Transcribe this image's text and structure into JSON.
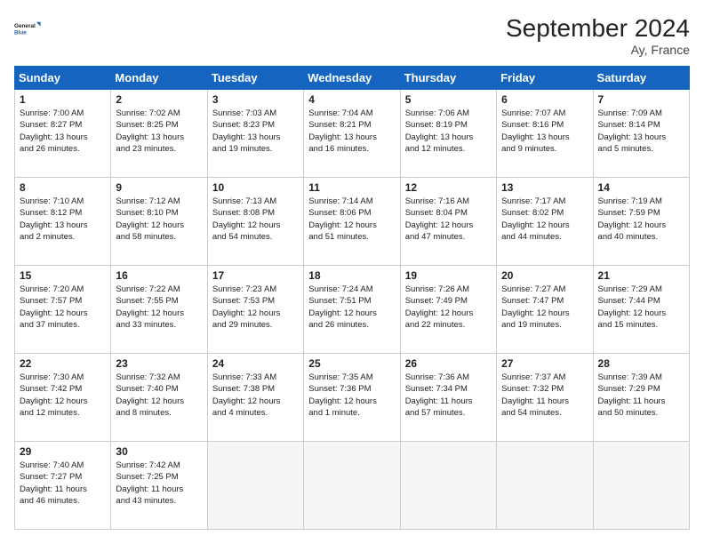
{
  "header": {
    "logo_line1": "General",
    "logo_line2": "Blue",
    "month": "September 2024",
    "location": "Ay, France"
  },
  "days_of_week": [
    "Sunday",
    "Monday",
    "Tuesday",
    "Wednesday",
    "Thursday",
    "Friday",
    "Saturday"
  ],
  "weeks": [
    [
      {
        "day": "1",
        "lines": [
          "Sunrise: 7:00 AM",
          "Sunset: 8:27 PM",
          "Daylight: 13 hours",
          "and 26 minutes."
        ]
      },
      {
        "day": "2",
        "lines": [
          "Sunrise: 7:02 AM",
          "Sunset: 8:25 PM",
          "Daylight: 13 hours",
          "and 23 minutes."
        ]
      },
      {
        "day": "3",
        "lines": [
          "Sunrise: 7:03 AM",
          "Sunset: 8:23 PM",
          "Daylight: 13 hours",
          "and 19 minutes."
        ]
      },
      {
        "day": "4",
        "lines": [
          "Sunrise: 7:04 AM",
          "Sunset: 8:21 PM",
          "Daylight: 13 hours",
          "and 16 minutes."
        ]
      },
      {
        "day": "5",
        "lines": [
          "Sunrise: 7:06 AM",
          "Sunset: 8:19 PM",
          "Daylight: 13 hours",
          "and 12 minutes."
        ]
      },
      {
        "day": "6",
        "lines": [
          "Sunrise: 7:07 AM",
          "Sunset: 8:16 PM",
          "Daylight: 13 hours",
          "and 9 minutes."
        ]
      },
      {
        "day": "7",
        "lines": [
          "Sunrise: 7:09 AM",
          "Sunset: 8:14 PM",
          "Daylight: 13 hours",
          "and 5 minutes."
        ]
      }
    ],
    [
      {
        "day": "8",
        "lines": [
          "Sunrise: 7:10 AM",
          "Sunset: 8:12 PM",
          "Daylight: 13 hours",
          "and 2 minutes."
        ]
      },
      {
        "day": "9",
        "lines": [
          "Sunrise: 7:12 AM",
          "Sunset: 8:10 PM",
          "Daylight: 12 hours",
          "and 58 minutes."
        ]
      },
      {
        "day": "10",
        "lines": [
          "Sunrise: 7:13 AM",
          "Sunset: 8:08 PM",
          "Daylight: 12 hours",
          "and 54 minutes."
        ]
      },
      {
        "day": "11",
        "lines": [
          "Sunrise: 7:14 AM",
          "Sunset: 8:06 PM",
          "Daylight: 12 hours",
          "and 51 minutes."
        ]
      },
      {
        "day": "12",
        "lines": [
          "Sunrise: 7:16 AM",
          "Sunset: 8:04 PM",
          "Daylight: 12 hours",
          "and 47 minutes."
        ]
      },
      {
        "day": "13",
        "lines": [
          "Sunrise: 7:17 AM",
          "Sunset: 8:02 PM",
          "Daylight: 12 hours",
          "and 44 minutes."
        ]
      },
      {
        "day": "14",
        "lines": [
          "Sunrise: 7:19 AM",
          "Sunset: 7:59 PM",
          "Daylight: 12 hours",
          "and 40 minutes."
        ]
      }
    ],
    [
      {
        "day": "15",
        "lines": [
          "Sunrise: 7:20 AM",
          "Sunset: 7:57 PM",
          "Daylight: 12 hours",
          "and 37 minutes."
        ]
      },
      {
        "day": "16",
        "lines": [
          "Sunrise: 7:22 AM",
          "Sunset: 7:55 PM",
          "Daylight: 12 hours",
          "and 33 minutes."
        ]
      },
      {
        "day": "17",
        "lines": [
          "Sunrise: 7:23 AM",
          "Sunset: 7:53 PM",
          "Daylight: 12 hours",
          "and 29 minutes."
        ]
      },
      {
        "day": "18",
        "lines": [
          "Sunrise: 7:24 AM",
          "Sunset: 7:51 PM",
          "Daylight: 12 hours",
          "and 26 minutes."
        ]
      },
      {
        "day": "19",
        "lines": [
          "Sunrise: 7:26 AM",
          "Sunset: 7:49 PM",
          "Daylight: 12 hours",
          "and 22 minutes."
        ]
      },
      {
        "day": "20",
        "lines": [
          "Sunrise: 7:27 AM",
          "Sunset: 7:47 PM",
          "Daylight: 12 hours",
          "and 19 minutes."
        ]
      },
      {
        "day": "21",
        "lines": [
          "Sunrise: 7:29 AM",
          "Sunset: 7:44 PM",
          "Daylight: 12 hours",
          "and 15 minutes."
        ]
      }
    ],
    [
      {
        "day": "22",
        "lines": [
          "Sunrise: 7:30 AM",
          "Sunset: 7:42 PM",
          "Daylight: 12 hours",
          "and 12 minutes."
        ]
      },
      {
        "day": "23",
        "lines": [
          "Sunrise: 7:32 AM",
          "Sunset: 7:40 PM",
          "Daylight: 12 hours",
          "and 8 minutes."
        ]
      },
      {
        "day": "24",
        "lines": [
          "Sunrise: 7:33 AM",
          "Sunset: 7:38 PM",
          "Daylight: 12 hours",
          "and 4 minutes."
        ]
      },
      {
        "day": "25",
        "lines": [
          "Sunrise: 7:35 AM",
          "Sunset: 7:36 PM",
          "Daylight: 12 hours",
          "and 1 minute."
        ]
      },
      {
        "day": "26",
        "lines": [
          "Sunrise: 7:36 AM",
          "Sunset: 7:34 PM",
          "Daylight: 11 hours",
          "and 57 minutes."
        ]
      },
      {
        "day": "27",
        "lines": [
          "Sunrise: 7:37 AM",
          "Sunset: 7:32 PM",
          "Daylight: 11 hours",
          "and 54 minutes."
        ]
      },
      {
        "day": "28",
        "lines": [
          "Sunrise: 7:39 AM",
          "Sunset: 7:29 PM",
          "Daylight: 11 hours",
          "and 50 minutes."
        ]
      }
    ],
    [
      {
        "day": "29",
        "lines": [
          "Sunrise: 7:40 AM",
          "Sunset: 7:27 PM",
          "Daylight: 11 hours",
          "and 46 minutes."
        ]
      },
      {
        "day": "30",
        "lines": [
          "Sunrise: 7:42 AM",
          "Sunset: 7:25 PM",
          "Daylight: 11 hours",
          "and 43 minutes."
        ]
      },
      {
        "day": "",
        "lines": []
      },
      {
        "day": "",
        "lines": []
      },
      {
        "day": "",
        "lines": []
      },
      {
        "day": "",
        "lines": []
      },
      {
        "day": "",
        "lines": []
      }
    ]
  ]
}
